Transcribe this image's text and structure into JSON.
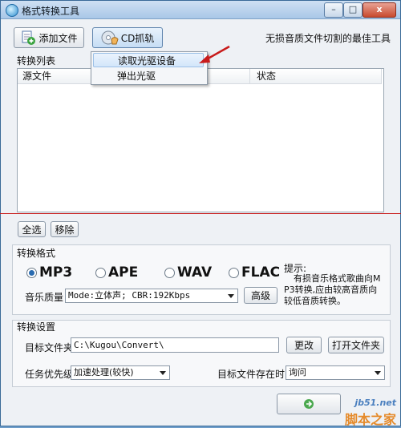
{
  "window": {
    "title": "格式转换工具",
    "minimize": "–",
    "maximize": "□",
    "close": "x"
  },
  "toolbar": {
    "add_file": "添加文件",
    "cd_rip": "CD抓轨",
    "slogan": "无损音质文件切割的最佳工具"
  },
  "cd_menu": {
    "items": [
      "读取光驱设备",
      "弹出光驱"
    ]
  },
  "list": {
    "group_label": "转换列表",
    "columns": [
      "源文件",
      "状态"
    ]
  },
  "list_buttons": {
    "select_all": "全选",
    "remove": "移除"
  },
  "format": {
    "group_label": "转换格式",
    "options": [
      "MP3",
      "APE",
      "WAV",
      "FLAC"
    ],
    "selected": "MP3",
    "quality_label": "音乐质量",
    "quality_value": "Mode:立体声; CBR:192Kbps",
    "advanced": "高级",
    "hint_title": "提示:",
    "hint_text": "有损音乐格式歌曲向MP3转换,应由较高音质向较低音质转换。"
  },
  "settings": {
    "group_label": "转换设置",
    "target_folder_label": "目标文件夹",
    "target_folder_value": "C:\\Kugou\\Convert\\",
    "change": "更改",
    "open_folder": "打开文件夹",
    "priority_label": "任务优先级",
    "priority_value": "加速处理(较快)",
    "exists_label": "目标文件存在时",
    "exists_value": "询问"
  },
  "watermark": {
    "line1": "jb51.net",
    "line2": "脚本之家"
  },
  "colors": {
    "annotation_red": "#c81b1b",
    "title_gradient_top": "#cfe0f3"
  }
}
